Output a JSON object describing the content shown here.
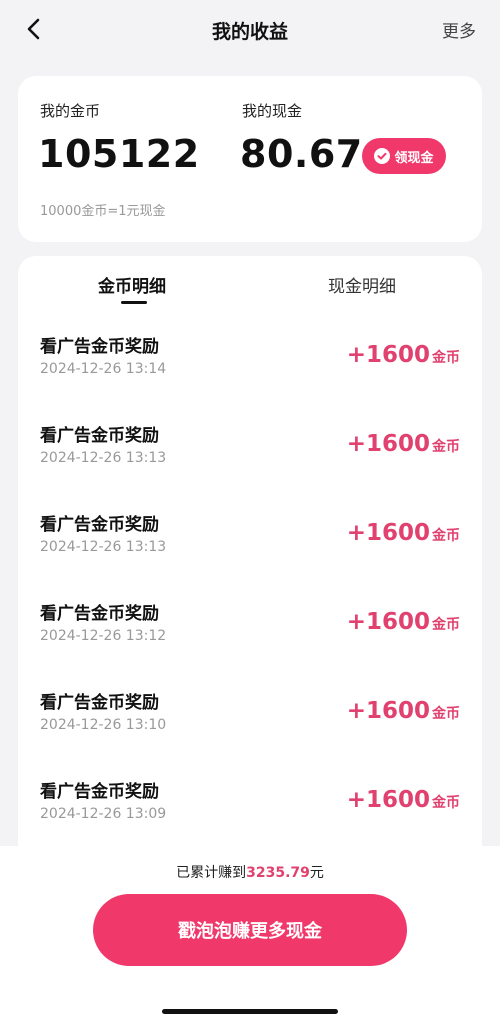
{
  "header": {
    "title": "我的收益",
    "more_label": "更多"
  },
  "summary": {
    "coin_label": "我的金币",
    "coin_value": "105122",
    "cash_label": "我的现金",
    "cash_value": "80.67",
    "withdraw_label": "领现金",
    "rate_note": "10000金币=1元现金"
  },
  "tabs": [
    {
      "label": "金币明细",
      "active": true
    },
    {
      "label": "现金明细",
      "active": false
    }
  ],
  "records": [
    {
      "title": "看广告金币奖励",
      "time": "2024-12-26 13:14",
      "amount": "+1600",
      "unit": "金币"
    },
    {
      "title": "看广告金币奖励",
      "time": "2024-12-26 13:13",
      "amount": "+1600",
      "unit": "金币"
    },
    {
      "title": "看广告金币奖励",
      "time": "2024-12-26 13:13",
      "amount": "+1600",
      "unit": "金币"
    },
    {
      "title": "看广告金币奖励",
      "time": "2024-12-26 13:12",
      "amount": "+1600",
      "unit": "金币"
    },
    {
      "title": "看广告金币奖励",
      "time": "2024-12-26 13:10",
      "amount": "+1600",
      "unit": "金币"
    },
    {
      "title": "看广告金币奖励",
      "time": "2024-12-26 13:09",
      "amount": "+1600",
      "unit": "金币"
    }
  ],
  "footer": {
    "earned_prefix": "已累计赚到",
    "earned_amount": "3235.79",
    "earned_suffix": "元",
    "cta_label": "戳泡泡赚更多现金"
  },
  "colors": {
    "accent": "#f0386b",
    "amount": "#e0416f",
    "background": "#f3f3f5"
  },
  "icons": {
    "back": "chevron-left-icon",
    "withdraw": "check-badge-icon"
  }
}
